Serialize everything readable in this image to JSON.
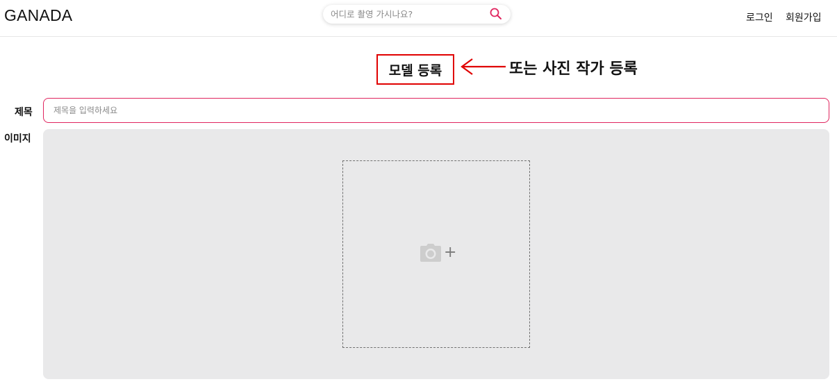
{
  "header": {
    "logo": "GANADA",
    "search": {
      "placeholder": "어디로 촬영 가시나요?"
    },
    "nav": {
      "login": "로그인",
      "signup": "회원가입"
    }
  },
  "main": {
    "page_title": "모델 등록",
    "annotation": "또는 사진 작가 등록",
    "form": {
      "title_label": "제목",
      "title_placeholder": "제목을 입력하세요",
      "title_value": "",
      "image_label": "이미지",
      "upload_plus": "+"
    }
  },
  "colors": {
    "accent": "#e0245e",
    "annotation_red": "#e00000",
    "panel_bg": "#e9e9ea"
  },
  "icons": {
    "search": "search-icon",
    "camera": "camera-icon",
    "arrow": "arrow-left-icon"
  }
}
